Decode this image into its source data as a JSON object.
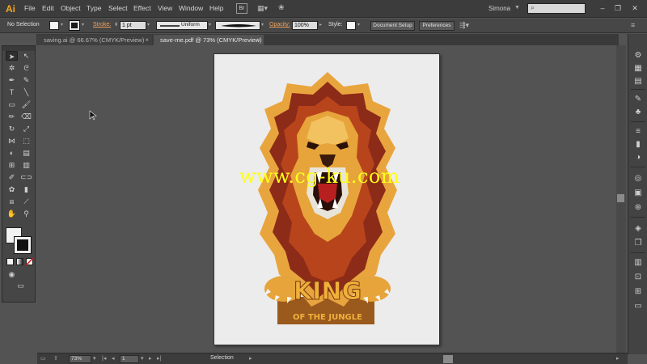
{
  "app": {
    "logo": "Ai"
  },
  "menubar": {
    "items": [
      "File",
      "Edit",
      "Object",
      "Type",
      "Select",
      "Effect",
      "View",
      "Window",
      "Help"
    ],
    "bridge_label": "Br",
    "workspace": "Simona"
  },
  "control_bar": {
    "selection_label": "No Selection",
    "stroke_label": "Stroke:",
    "stroke_weight": "1 pt",
    "stroke_profile": "Uniform",
    "opacity_label": "Opacity:",
    "opacity_value": "100%",
    "style_label": "Style:",
    "document_setup": "Document Setup",
    "preferences": "Preferences"
  },
  "tabs": [
    {
      "label": "saving.ai @ 66.67% (CMYK/Preview)",
      "active": false
    },
    {
      "label": "save-me.pdf @ 73% (CMYK/Preview)",
      "active": true
    }
  ],
  "artwork": {
    "title_word": "KING",
    "subtitle": "OF THE JUNGLE",
    "watermark": "www.cg-ku.com"
  },
  "status_bar": {
    "zoom": "73%",
    "page": "1",
    "tool_status": "Selection"
  },
  "colors": {
    "accent": "#f0a35a",
    "mane_dark": "#8c2b18",
    "mane_mid": "#b8441c",
    "face": "#e6a43a",
    "banner": "#9a5a1e"
  }
}
